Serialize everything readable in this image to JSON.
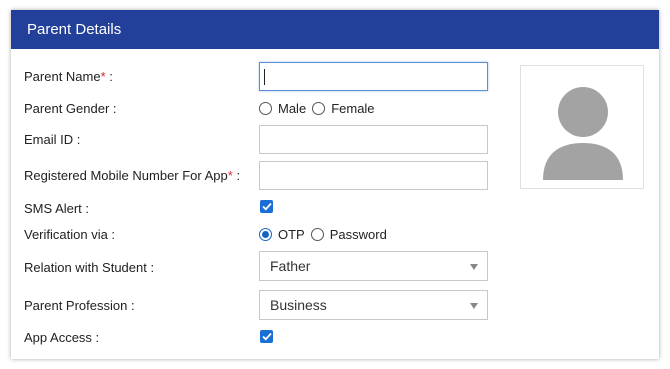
{
  "header": {
    "title": "Parent Details"
  },
  "form": {
    "parent_name": {
      "label": "Parent Name",
      "required_mark": "*",
      "suffix": " :",
      "value": ""
    },
    "parent_gender": {
      "label": "Parent Gender :",
      "options": [
        "Male",
        "Female"
      ],
      "selected": null
    },
    "email": {
      "label": "Email ID :",
      "value": ""
    },
    "mobile": {
      "label": "Registered Mobile Number For App",
      "required_mark": "*",
      "suffix": " :",
      "value": ""
    },
    "sms_alert": {
      "label": "SMS Alert :",
      "checked": true
    },
    "verification": {
      "label": "Verification via :",
      "options": [
        "OTP",
        "Password"
      ],
      "selected": "OTP"
    },
    "relation": {
      "label": "Relation with Student :",
      "value": "Father"
    },
    "profession": {
      "label": "Parent Profession :",
      "value": "Business"
    },
    "app_access": {
      "label": "App Access :",
      "checked": true
    }
  },
  "photo": {
    "icon": "avatar-placeholder-icon"
  },
  "colors": {
    "header_bg": "#22409a",
    "required": "#d8262f",
    "accent": "#1a6fd6"
  }
}
